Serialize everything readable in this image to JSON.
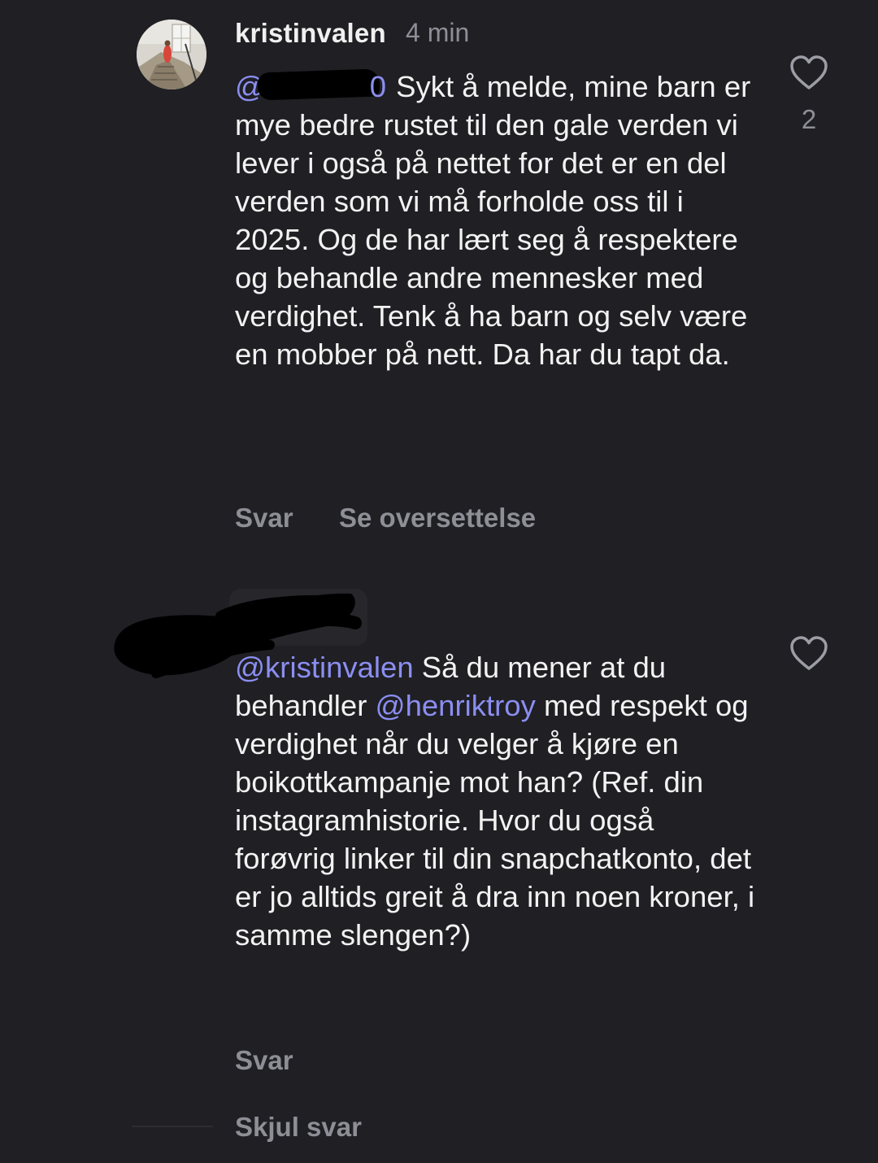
{
  "comments": [
    {
      "username": "kristinvalen",
      "time": "4 min",
      "mention_start": "@",
      "mention_end": "0",
      "text": "Sykt å melde, mine barn er mye bedre rustet til den gale verden vi lever i også på nettet for det er en del verden som vi må forholde oss til i 2025. Og de har lært seg å respektere og behandle andre mennesker med verdighet. Tenk å ha barn og selv være en mobber på nett. Da har du tapt da.",
      "like_count": "2",
      "reply_label": "Svar",
      "translate_label": "Se oversettelse"
    },
    {
      "mention_1": "@kristinvalen",
      "text_1": " Så du mener at du behandler ",
      "mention_2": "@henriktroy",
      "text_2": " med respekt og verdighet når du velger å kjøre en boikottkampanje mot han? (Ref. din instagramhistorie. Hvor du også forøvrig linker til din snapchatkonto, det er jo alltids greit å dra inn noen kroner, i samme slengen?)",
      "reply_label": "Svar"
    }
  ],
  "thread": {
    "hide_replies_label": "Skjul svar"
  },
  "icons": {
    "like": "heart-outline-icon"
  },
  "colors": {
    "background": "#1f1f24",
    "mention": "#8b8ef0",
    "muted": "#8e8e96"
  }
}
